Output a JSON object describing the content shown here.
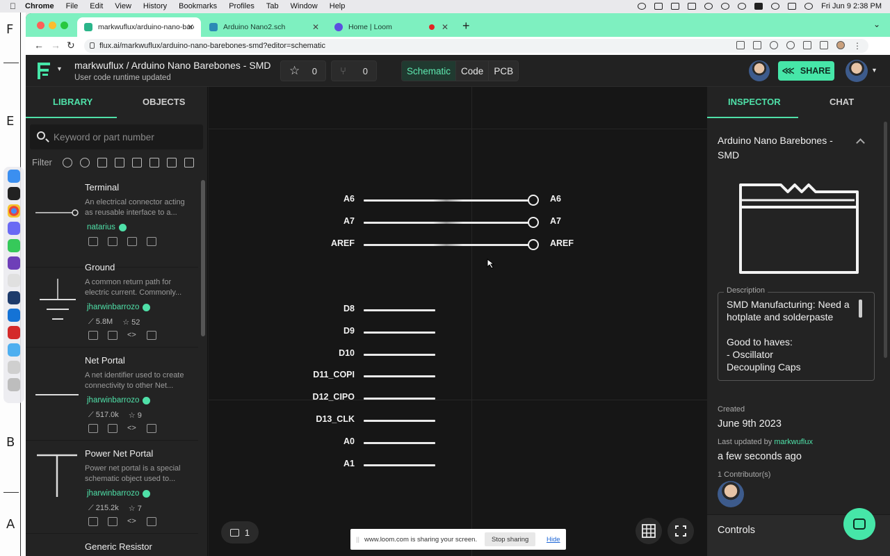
{
  "menubar": {
    "app": "Chrome",
    "items": [
      "File",
      "Edit",
      "View",
      "History",
      "Bookmarks",
      "Profiles",
      "Tab",
      "Window",
      "Help"
    ],
    "clock": "Fri Jun 9  2:38 PM"
  },
  "paper": {
    "letters": [
      "F",
      "E",
      "B",
      "A"
    ]
  },
  "browser": {
    "tabs": [
      {
        "title": "markwuflux/arduino-nano-bare",
        "favicon_color": "#2bb58a"
      },
      {
        "title": "Arduino Nano2.sch",
        "favicon_color": "#2b8ab5"
      },
      {
        "title": "Home | Loom",
        "favicon_color": "#5b4fe0"
      }
    ],
    "url": "flux.ai/markwuflux/arduino-nano-barebones-smd?editor=schematic"
  },
  "header": {
    "title": "markwuflux / Arduino Nano Barebones - SMD",
    "status": "User code runtime updated",
    "star_count": "0",
    "fork_count": "0",
    "modes": [
      "Schematic",
      "Code",
      "PCB"
    ],
    "share_label": "SHARE"
  },
  "library": {
    "tabs": [
      "LIBRARY",
      "OBJECTS"
    ],
    "search_placeholder": "Keyword or part number",
    "filter_label": "Filter",
    "cards": [
      {
        "name": "Terminal",
        "desc": "An electrical connector acting as reusable interface to a...",
        "author": "natarius",
        "trend": "",
        "stars": ""
      },
      {
        "name": "Ground",
        "desc": "A common return path for electric current. Commonly...",
        "author": "jharwinbarrozo",
        "trend": "5.8M",
        "stars": "52"
      },
      {
        "name": "Net Portal",
        "desc": "A net identifier used to create connectivity to other Net...",
        "author": "jharwinbarrozo",
        "trend": "517.0k",
        "stars": "9"
      },
      {
        "name": "Power Net Portal",
        "desc": "Power net portal is a special schematic object used to...",
        "author": "jharwinbarrozo",
        "trend": "215.2k",
        "stars": "7"
      },
      {
        "name": "Generic Resistor",
        "desc": "",
        "author": "",
        "trend": "",
        "stars": ""
      }
    ]
  },
  "canvas": {
    "pins_top": [
      {
        "left": "A6",
        "right": "A6"
      },
      {
        "left": "A7",
        "right": "A7"
      },
      {
        "left": "AREF",
        "right": "AREF"
      }
    ],
    "pins_bottom": [
      "D8",
      "D9",
      "D10",
      "D11_COPI",
      "D12_CIPO",
      "D13_CLK",
      "A0",
      "A1"
    ],
    "comment_count": "1",
    "loom_message": "www.loom.com is sharing your screen.",
    "loom_stop": "Stop sharing",
    "loom_hide": "Hide"
  },
  "inspector": {
    "tabs": [
      "INSPECTOR",
      "CHAT"
    ],
    "title": "Arduino Nano Barebones - SMD",
    "description_label": "Description",
    "description": "SMD Manufacturing: Need a hotplate and solderpaste\n\nGood to haves:\n- Oscillator\nDecoupling Caps",
    "created_label": "Created",
    "created": "June 9th 2023",
    "updated_label": "Last updated by",
    "updated_by": "markwuflux",
    "updated": "a few seconds ago",
    "contributors_label": "1 Contributor(s)",
    "controls_label": "Controls"
  },
  "colors": {
    "accent": "#46e6a8",
    "tabbar": "#7ef0c0",
    "canvas": "#161616",
    "panel": "#232323"
  }
}
